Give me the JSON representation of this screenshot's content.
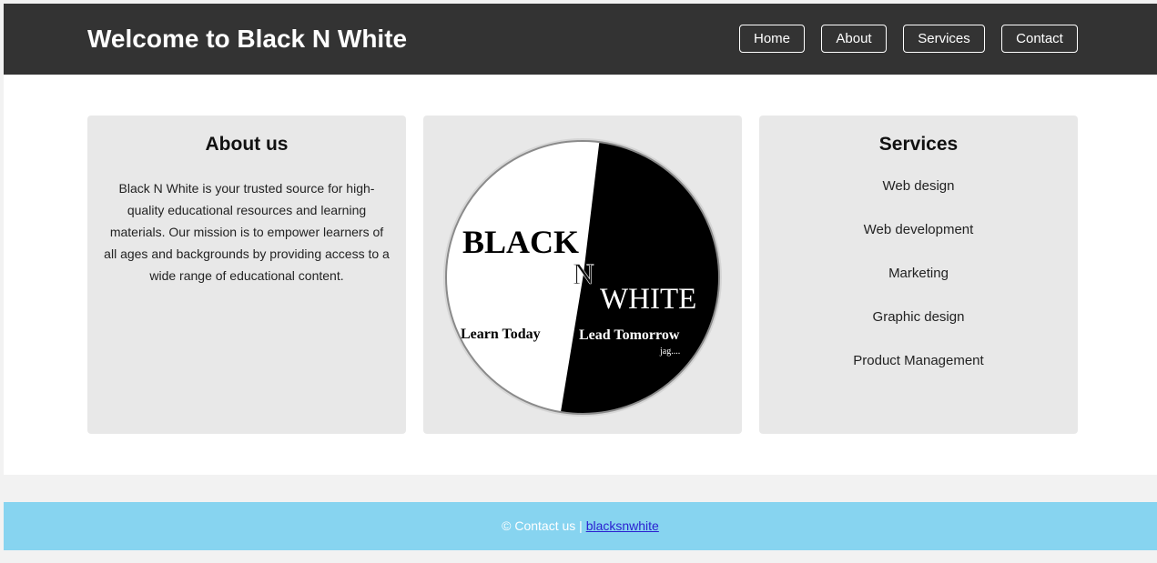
{
  "header": {
    "title": "Welcome to Black N White",
    "nav": [
      "Home",
      "About",
      "Services",
      "Contact"
    ]
  },
  "about": {
    "heading": "About us",
    "text": "Black N White is your trusted source for high-quality educational resources and learning materials. Our mission is to empower learners of all ages and backgrounds by providing access to a wide range of educational content."
  },
  "logo": {
    "word1": "BLACK",
    "word2": "N",
    "word3": "WHITE",
    "tagline_left": "Learn Today",
    "tagline_right": "Lead Tomorrow",
    "signature": "jag...."
  },
  "services": {
    "heading": "Services",
    "items": [
      "Web design",
      "Web development",
      "Marketing",
      "Graphic design",
      "Product Management"
    ]
  },
  "footer": {
    "text": "© Contact us | ",
    "link": "blacksnwhite"
  },
  "colors": {
    "header_bg": "#333333",
    "card_bg": "#e8e8e8",
    "footer_bg": "#87d4f0",
    "link": "#2a1fd0"
  }
}
